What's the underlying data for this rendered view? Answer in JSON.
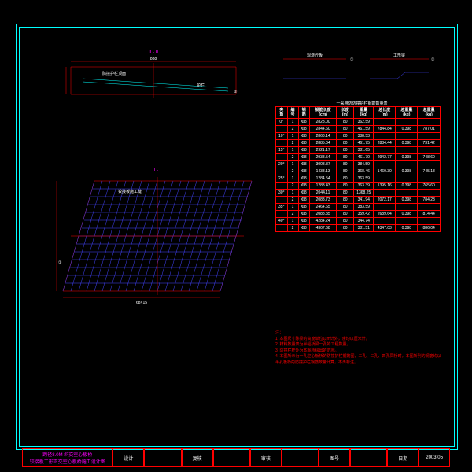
{
  "section_labels": {
    "top": "II - II",
    "bottom": "I - I"
  },
  "dims": {
    "top_span": "888",
    "bot_span": "68×15",
    "bot_h": "600"
  },
  "legend": {
    "left": "现浇砼板",
    "right": "工形梁",
    "n1": "①",
    "n2": "②"
  },
  "table_title": "一采用防防撞护栏钢筋数量表",
  "headers": [
    "夹角",
    "编号",
    "钢筋",
    "钢筋长度 (cm)",
    "长度 (m)",
    "重量 (kg)",
    "总长度 (m)",
    "总重量 (kg)",
    "总重量 (kg)"
  ],
  "rows": [
    [
      "0°",
      "1",
      "Φ8",
      "2828.00",
      "80",
      "362.59",
      "",
      "",
      ""
    ],
    [
      "",
      "2",
      "Φ8",
      "2844.60",
      "80",
      "461.59",
      "7844.84",
      "0.398",
      "787.01"
    ],
    [
      "10°",
      "1",
      "Φ8",
      "2868.14",
      "80",
      "388.53",
      "",
      "",
      ""
    ],
    [
      "",
      "2",
      "Φ8",
      "2885.04",
      "80",
      "461.75",
      "2884.44",
      "0.398",
      "731.42"
    ],
    [
      "15°",
      "1",
      "Φ8",
      "2921.17",
      "80",
      "381.65",
      "",
      "",
      ""
    ],
    [
      "",
      "2",
      "Φ8",
      "2938.54",
      "80",
      "461.70",
      "2942.77",
      "0.398",
      "748.60"
    ],
    [
      "20°",
      "1",
      "Φ8",
      "3008.37",
      "80",
      "384.59",
      "",
      "",
      ""
    ],
    [
      "",
      "2",
      "Φ8",
      "1438.13",
      "80",
      "368.46",
      "1460.30",
      "0.398",
      "745.18"
    ],
    [
      "25°",
      "1",
      "Φ8",
      "1284.54",
      "80",
      "363.59",
      "",
      "",
      ""
    ],
    [
      "",
      "2",
      "Φ8",
      "1283.43",
      "80",
      "363.39",
      "1395.16",
      "0.398",
      "765.60"
    ],
    [
      "30°",
      "1",
      "Φ8",
      "2044.11",
      "80",
      "1368.25",
      "",
      "",
      ""
    ],
    [
      "",
      "2",
      "Φ8",
      "2083.73",
      "80",
      "341.94",
      "2072.17",
      "0.398",
      "784.23"
    ],
    [
      "35°",
      "1",
      "Φ8",
      "2464.65",
      "80",
      "383.59",
      "",
      "",
      ""
    ],
    [
      "",
      "2",
      "Φ8",
      "2088.35",
      "80",
      "359.42",
      "2689.64",
      "0.398",
      "814.44"
    ],
    [
      "40°",
      "1",
      "Φ8",
      "4284.24",
      "80",
      "344.74",
      "",
      "",
      ""
    ],
    [
      "",
      "2",
      "Φ8",
      "4307.68",
      "80",
      "381.51",
      "4347.03",
      "0.398",
      "886.04"
    ]
  ],
  "notes_title": "注：",
  "notes": [
    "1. 本图尺寸除梁的高度单位以m计外，余均以厘米计。",
    "2. 材料数量表为半幅桥梁一孔的工程数量。",
    "3. 防撞栏杆外为本图所绘出的范围。",
    "4. 本图所示为一孔空心板桥的防撞护栏钢筋图，二孔、三孔、四孔同桥时，本图所列的钢筋均以半孔板桥的防撞护栏钢筋数量计算，不再标注。"
  ],
  "titleblock": {
    "proj1": "跨径8.0M 斜交空心板桥",
    "proj2": "铰接板工形正交空心板桥施工设计图",
    "c1": "设计",
    "c2": "复核",
    "c3": "审核",
    "c4": "图号",
    "c5": "日期",
    "date": "2003.05"
  },
  "annot": {
    "a1": "防撞护栏顶面",
    "a2": "护栏",
    "a3": "铰接板施工缝",
    "a4": "①",
    "a5": "②"
  }
}
